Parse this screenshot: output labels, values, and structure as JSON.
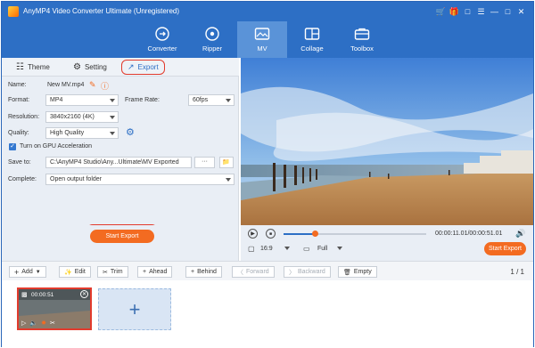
{
  "app": {
    "title": "AnyMP4 Video Converter Ultimate (Unregistered)",
    "accent": "#2d6fc5",
    "window_icons": [
      "cart-icon",
      "gift-icon",
      "chat-icon",
      "menu-icon",
      "minimize-icon",
      "maximize-icon",
      "close-icon"
    ]
  },
  "nav": {
    "items": [
      {
        "label": "Converter",
        "icon": "converter-icon"
      },
      {
        "label": "Ripper",
        "icon": "ripper-icon"
      },
      {
        "label": "MV",
        "icon": "mv-icon",
        "active": true
      },
      {
        "label": "Collage",
        "icon": "collage-icon"
      },
      {
        "label": "Toolbox",
        "icon": "toolbox-icon"
      }
    ]
  },
  "tabs": {
    "theme": "Theme",
    "setting": "Setting",
    "export": "Export"
  },
  "export": {
    "name_label": "Name:",
    "name_value": "New MV.mp4",
    "format_label": "Format:",
    "format_value": "MP4",
    "frame_rate_label": "Frame Rate:",
    "frame_rate_value": "60fps",
    "resolution_label": "Resolution:",
    "resolution_value": "3840x2160 (4K)",
    "quality_label": "Quality:",
    "quality_value": "High Quality",
    "gpu_label": "Turn on GPU Acceleration",
    "save_label": "Save to:",
    "save_value": "C:\\AnyMP4 Studio\\Any...Ultimate\\MV Exported",
    "browse_label": "···",
    "complete_label": "Complete:",
    "complete_value": "Open output folder",
    "start_export": "Start Export"
  },
  "player": {
    "time": "00:00:11.01/00:00:51.01",
    "progress": 0.22,
    "aspect": "16:9",
    "fit": "Full",
    "start_export": "Start Export"
  },
  "toolbar": {
    "add": "Add",
    "edit": "Edit",
    "trim": "Trim",
    "ahead": "Ahead",
    "behind": "Behind",
    "forward": "Forward",
    "backward": "Backward",
    "empty": "Empty",
    "page": "1 / 1"
  },
  "clip": {
    "duration": "00:00:51"
  }
}
